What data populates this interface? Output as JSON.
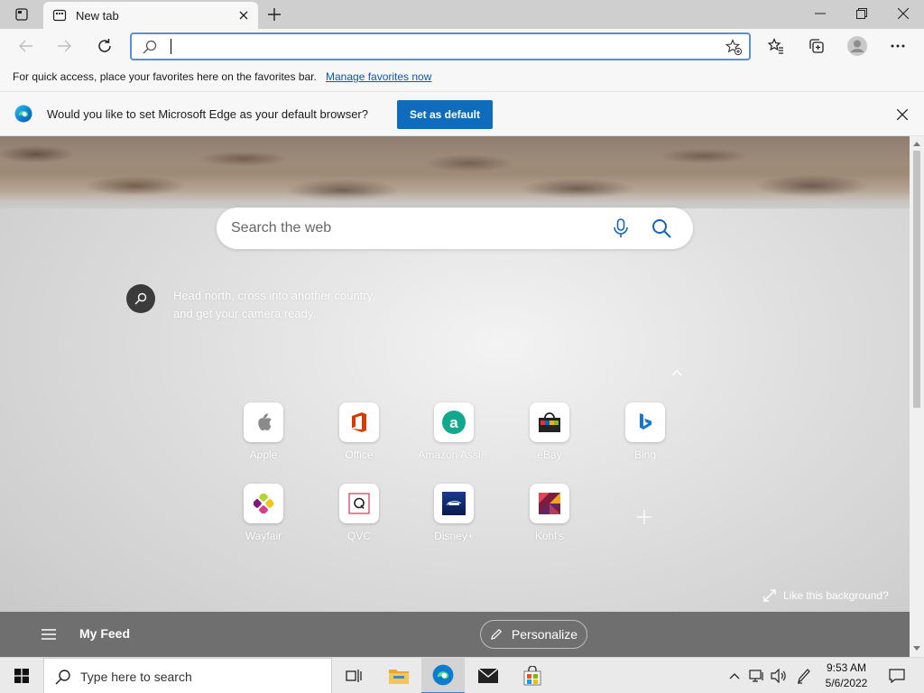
{
  "browser": {
    "tab": {
      "title": "New tab"
    },
    "address_bar": {
      "value": "",
      "placeholder": ""
    },
    "favorites_bar": {
      "text": "For quick access, place your favorites here on the favorites bar.",
      "link": "Manage favorites now"
    },
    "infobar": {
      "message": "Would you like to set Microsoft Edge as your default browser?",
      "button": "Set as default"
    }
  },
  "newtab": {
    "search": {
      "placeholder": "Search the web"
    },
    "fact": {
      "line1": "Head north, cross into another country,",
      "line2": "and get your camera ready."
    },
    "tiles": [
      {
        "label": "Apple",
        "icon": "apple-icon"
      },
      {
        "label": "Office",
        "icon": "office-icon"
      },
      {
        "label": "Amazon Assi...",
        "icon": "amazon-assistant-icon"
      },
      {
        "label": "eBay",
        "icon": "ebay-icon"
      },
      {
        "label": "Bing",
        "icon": "bing-icon"
      },
      {
        "label": "Wayfair",
        "icon": "wayfair-icon"
      },
      {
        "label": "QVC",
        "icon": "qvc-icon"
      },
      {
        "label": "Disney+",
        "icon": "disney-plus-icon"
      },
      {
        "label": "Kohl's",
        "icon": "kohls-icon"
      }
    ],
    "like_background": "Like this background?",
    "feed": {
      "label": "My Feed",
      "personalize": "Personalize"
    }
  },
  "taskbar": {
    "search_placeholder": "Type here to search",
    "time": "9:53 AM",
    "date": "5/6/2022"
  },
  "colors": {
    "accent": "#0f6cbd",
    "link": "#0a58b6",
    "feed_bar": "#6f6f6f"
  }
}
